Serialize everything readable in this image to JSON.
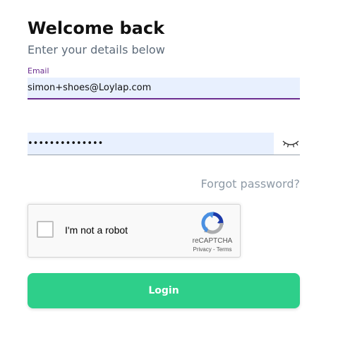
{
  "header": {
    "title": "Welcome back",
    "subtitle": "Enter your details below"
  },
  "email": {
    "label": "Email",
    "value": "simon+shoes@Loylap.com"
  },
  "password": {
    "value": "••••••••••••••",
    "toggle_icon": "eye-closed-icon"
  },
  "forgot_password": {
    "label": "Forgot password?"
  },
  "recaptcha": {
    "label": "I'm not a robot",
    "brand": "reCAPTCHA",
    "privacy": "Privacy",
    "separator": " - ",
    "terms": "Terms",
    "checked": false
  },
  "login": {
    "label": "Login"
  },
  "colors": {
    "accent": "#6b2d8f",
    "button": "#2ecf8a",
    "input_fill": "#e8f0fe",
    "muted_text": "#8e9aa6"
  }
}
